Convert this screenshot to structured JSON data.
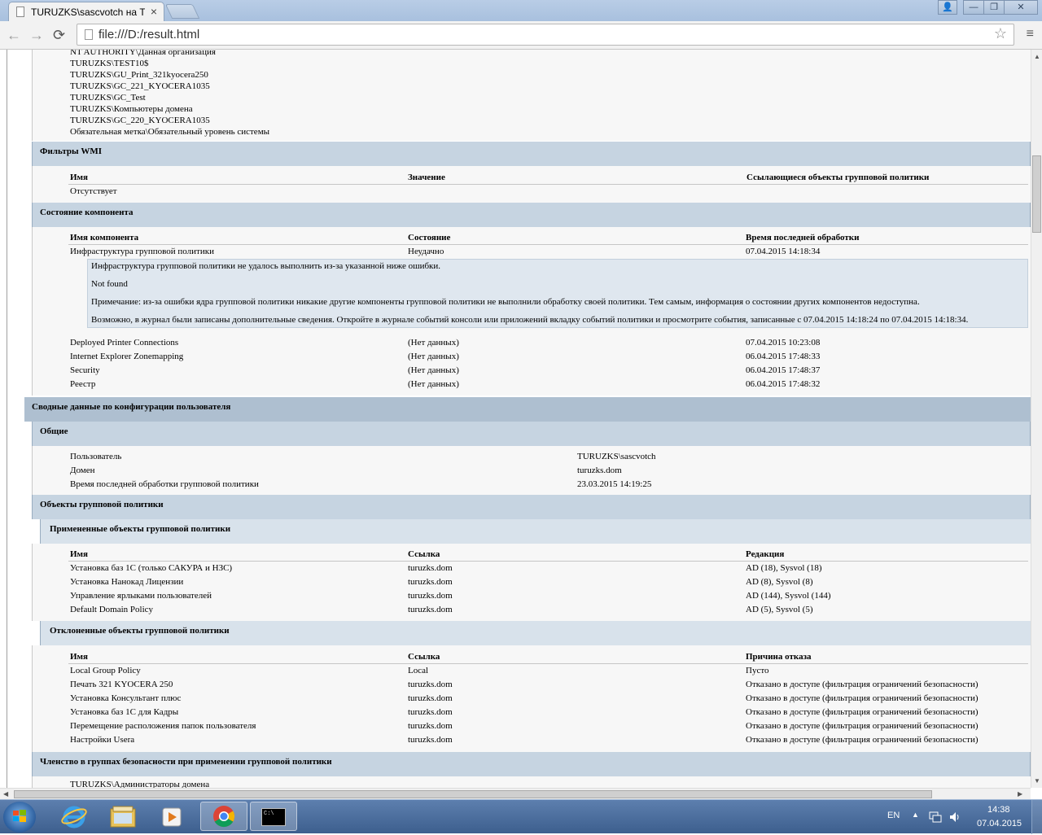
{
  "browser": {
    "tab_title": "TURUZKS\\sascvotch на TU",
    "url": "file:///D:/result.html",
    "controls": {
      "back": "←",
      "forward": "→",
      "reload": "⟳",
      "star": "☆",
      "menu": "≡",
      "tab_close": "×"
    },
    "window_buttons": {
      "user": "👤",
      "minimize": "—",
      "restore": "❐",
      "close": "✕"
    }
  },
  "report": {
    "security_groups_tail": [
      "NT AUTHORITY\\Данная организация",
      "TURUZKS\\TEST10$",
      "TURUZKS\\GU_Print_321kyocera250",
      "TURUZKS\\GC_221_KYOCERA1035",
      "TURUZKS\\GC_Test",
      "TURUZKS\\Компьютеры домена",
      "TURUZKS\\GC_220_KYOCERA1035",
      "Обязательная метка\\Обязательный уровень системы"
    ],
    "wmi": {
      "title": "Фильтры WMI",
      "headers": [
        "Имя",
        "Значение",
        "Ссылающиеся объекты групповой политики"
      ],
      "value": "Отсутствует"
    },
    "components": {
      "title": "Состояние компонента",
      "headers": [
        "Имя компонента",
        "Состояние",
        "Время последней обработки"
      ],
      "first_row": [
        "Инфраструктура групповой политики",
        "Неудачно",
        "07.04.2015 14:18:34"
      ],
      "error_lines": [
        "Инфраструктура групповой политики не удалось выполнить из-за указанной ниже ошибки.",
        "Not found",
        "Примечание: из-за ошибки ядра групповой политики никакие другие компоненты групповой политики не выполнили обработку своей политики. Тем самым, информация о состоянии других компонентов недоступна.",
        "Возможно, в журнал были записаны дополнительные сведения. Откройте в журнале событий консоли или приложений вкладку событий политики и просмотрите события, записанные с 07.04.2015 14:18:24 по 07.04.2015 14:18:34."
      ],
      "rows": [
        [
          "Deployed Printer Connections",
          "(Нет данных)",
          "07.04.2015 10:23:08"
        ],
        [
          "Internet Explorer Zonemapping",
          "(Нет данных)",
          "06.04.2015 17:48:33"
        ],
        [
          "Security",
          "(Нет данных)",
          "06.04.2015 17:48:37"
        ],
        [
          "Реестр",
          "(Нет данных)",
          "06.04.2015 17:48:32"
        ]
      ]
    },
    "user_summary": {
      "title": "Сводные данные по конфигурации пользователя",
      "general": {
        "title": "Общие",
        "rows": [
          [
            "Пользователь",
            "TURUZKS\\sascvotch"
          ],
          [
            "Домен",
            "turuzks.dom"
          ],
          [
            "Время последней обработки групповой политики",
            "23.03.2015 14:19:25"
          ]
        ]
      },
      "gpo": {
        "title": "Объекты групповой политики",
        "applied": {
          "title": "Примененные объекты групповой политики",
          "headers": [
            "Имя",
            "Ссылка",
            "Редакция"
          ],
          "rows": [
            [
              "Установка баз 1С (только САКУРА и НЗС)",
              "turuzks.dom",
              "AD (18), Sysvol (18)"
            ],
            [
              "Установка Нанокад Лицензии",
              "turuzks.dom",
              "AD (8), Sysvol (8)"
            ],
            [
              "Управление ярлыками пользователей",
              "turuzks.dom",
              "AD (144), Sysvol (144)"
            ],
            [
              "Default Domain Policy",
              "turuzks.dom",
              "AD (5), Sysvol (5)"
            ]
          ]
        },
        "denied": {
          "title": "Отклоненные объекты групповой политики",
          "headers": [
            "Имя",
            "Ссылка",
            "Причина отказа"
          ],
          "rows": [
            [
              "Local Group Policy",
              "Local",
              "Пусто"
            ],
            [
              "Печать 321 KYOCERA 250",
              "turuzks.dom",
              "Отказано в доступе (фильтрация ограничений безопасности)"
            ],
            [
              "Установка Консультант плюс",
              "turuzks.dom",
              "Отказано в доступе (фильтрация ограничений безопасности)"
            ],
            [
              "Установка баз 1С для Кадры",
              "turuzks.dom",
              "Отказано в доступе (фильтрация ограничений безопасности)"
            ],
            [
              "Перемещение расположения папок пользователя",
              "turuzks.dom",
              "Отказано в доступе (фильтрация ограничений безопасности)"
            ],
            [
              "Настройки Usera",
              "turuzks.dom",
              "Отказано в доступе (фильтрация ограничений безопасности)"
            ]
          ]
        }
      },
      "membership": {
        "title": "Членство в группах безопасности при применении групповой политики",
        "first_item": "TURUZKS\\Администраторы домена"
      }
    }
  },
  "taskbar": {
    "language": "EN",
    "time": "14:38",
    "date": "07.04.2015",
    "cmd_label": "C:\\"
  }
}
